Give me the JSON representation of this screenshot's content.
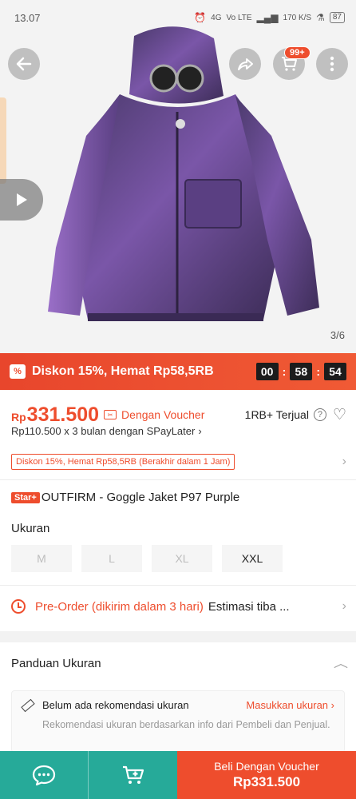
{
  "status_bar": {
    "time": "13.07",
    "network_1": "4G",
    "network_2": "Vo LTE",
    "speed": "170 K/S",
    "battery": "87"
  },
  "gallery": {
    "page_indicator": "3/6",
    "cart_badge": "99+",
    "icons": [
      "back-arrow-icon",
      "share-icon",
      "cart-icon",
      "more-icon",
      "play-icon"
    ]
  },
  "flash_sale": {
    "text": "Diskon 15%, Hemat Rp58,5RB",
    "hours": "00",
    "minutes": "58",
    "seconds": "54"
  },
  "price": {
    "currency": "Rp",
    "value": "331.500",
    "voucher_label": "Dengan Voucher",
    "sold": "1RB+ Terjual",
    "installment": "Rp110.500 x 3 bulan dengan SPayLater"
  },
  "promo": {
    "tag": "Diskon 15%, Hemat Rp58,5RB (Berakhir dalam 1 Jam)"
  },
  "product": {
    "badge": "Star+",
    "title": "OUTFIRM - Goggle Jaket P97 Purple"
  },
  "size": {
    "heading": "Ukuran",
    "options": [
      "M",
      "L",
      "XL",
      "XXL"
    ]
  },
  "preorder": {
    "label": "Pre-Order (dikirim dalam 3 hari)",
    "estimate": "Estimasi tiba ..."
  },
  "size_guide": {
    "title": "Panduan Ukuran",
    "reco_title": "Belum ada rekomendasi ukuran",
    "reco_link": "Masukkan ukuran",
    "reco_desc": "Rekomendasi ukuran berdasarkan info dari Pembeli dan Penjual."
  },
  "bottom_bar": {
    "buy_label": "Beli Dengan Voucher",
    "buy_price": "Rp331.500"
  },
  "colors": {
    "accent": "#ee4d2d",
    "chat_green": "#26aa99",
    "jacket": "#6b4a8c"
  }
}
